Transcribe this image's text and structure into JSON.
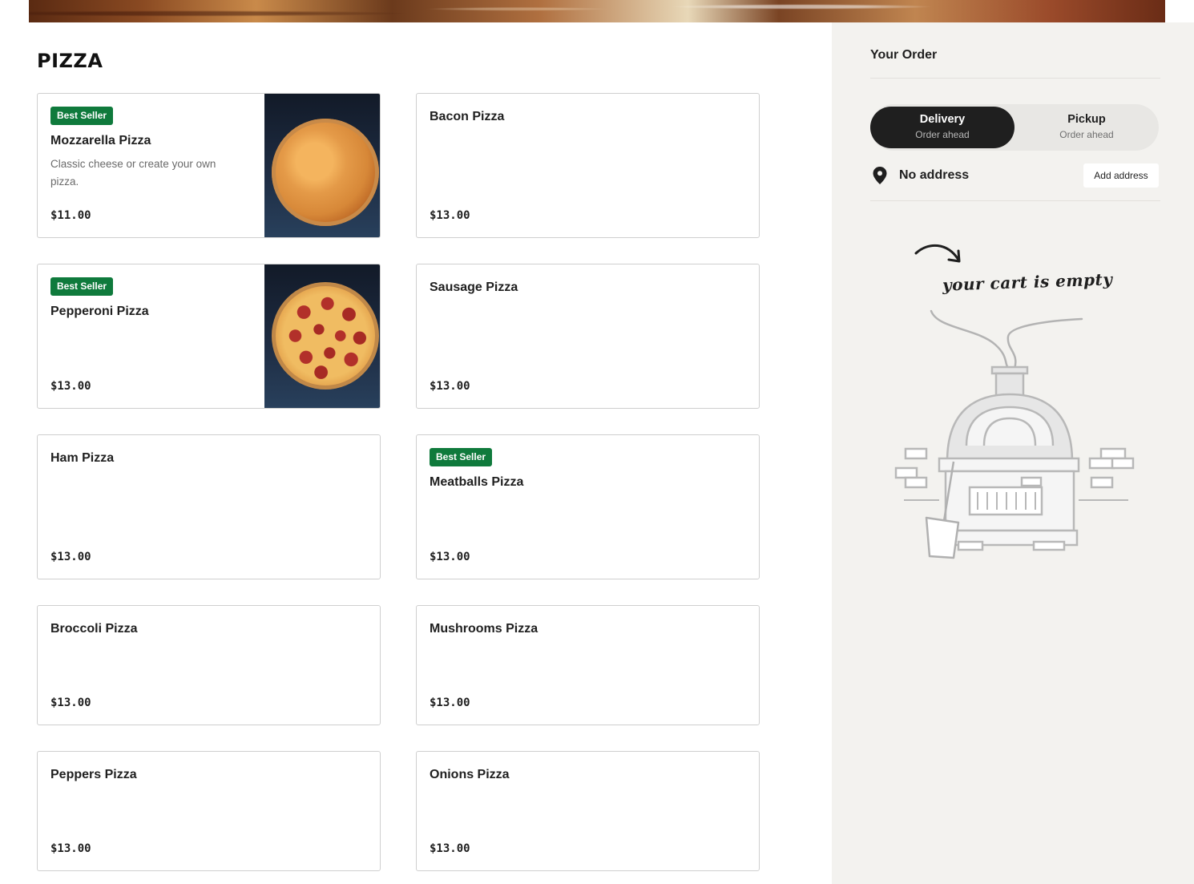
{
  "menu": {
    "section_title": "PIZZA",
    "items": [
      {
        "name": "Mozzarella Pizza",
        "description": "Classic cheese or create your own pizza.",
        "price": "$11.00",
        "badge": "Best Seller"
      },
      {
        "name": "Bacon Pizza",
        "price": "$13.00"
      },
      {
        "name": "Pepperoni Pizza",
        "price": "$13.00",
        "badge": "Best Seller"
      },
      {
        "name": "Sausage Pizza",
        "price": "$13.00"
      },
      {
        "name": "Ham Pizza",
        "price": "$13.00"
      },
      {
        "name": "Meatballs Pizza",
        "price": "$13.00",
        "badge": "Best Seller"
      },
      {
        "name": "Broccoli Pizza",
        "price": "$13.00"
      },
      {
        "name": "Mushrooms Pizza",
        "price": "$13.00"
      },
      {
        "name": "Peppers Pizza",
        "price": "$13.00"
      },
      {
        "name": "Onions Pizza",
        "price": "$13.00"
      }
    ]
  },
  "order": {
    "title": "Your Order",
    "delivery": {
      "label": "Delivery",
      "sub": "Order ahead",
      "selected": true
    },
    "pickup": {
      "label": "Pickup",
      "sub": "Order ahead",
      "selected": false
    },
    "address": {
      "text": "No address",
      "button": "Add address",
      "icon": "map-pin-icon"
    },
    "empty_message": "your cart is empty"
  },
  "colors": {
    "badge_green": "#0f7a3c",
    "sidebar_bg": "#f3f2ef",
    "toggle_active": "#1f1f1f"
  }
}
